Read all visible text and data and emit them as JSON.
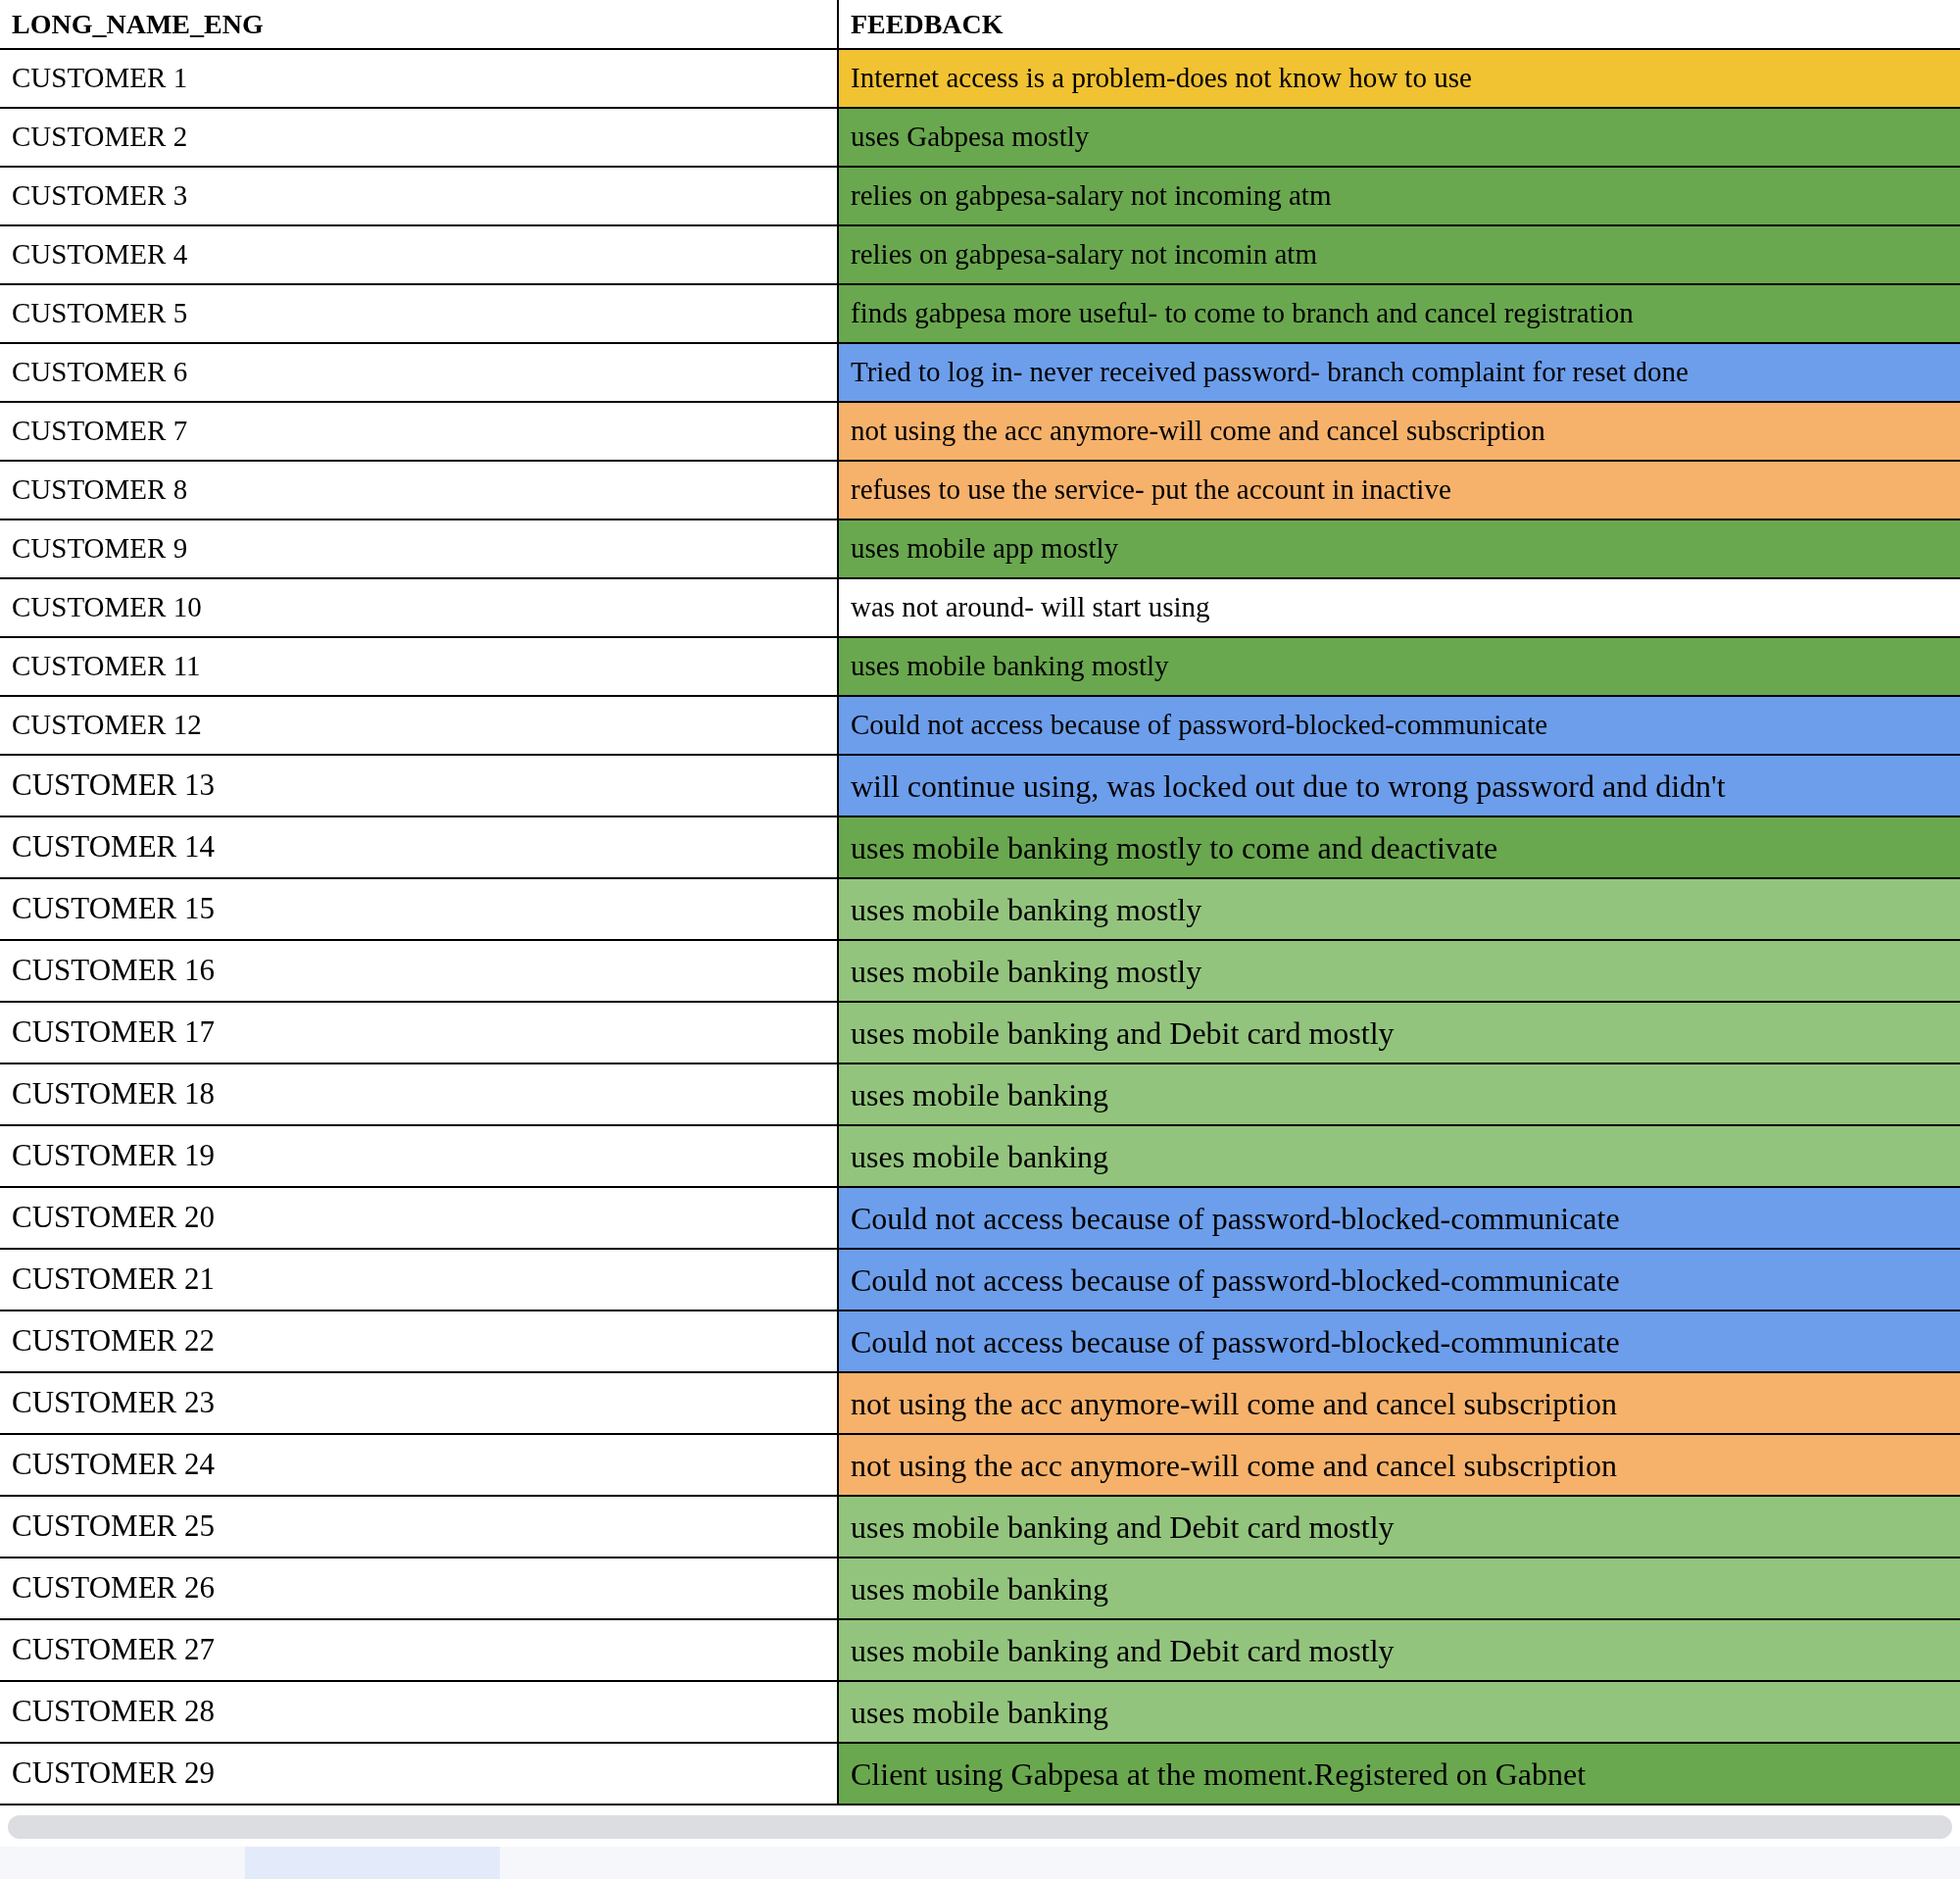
{
  "table": {
    "columns": [
      "LONG_NAME_ENG",
      "FEEDBACK"
    ],
    "rows": [
      {
        "name": "CUSTOMER 1",
        "feedback": "Internet access is a problem-does not know how to use",
        "color": "#f1c232"
      },
      {
        "name": "CUSTOMER 2",
        "feedback": "uses Gabpesa mostly",
        "color": "#6aa84f"
      },
      {
        "name": "CUSTOMER 3",
        "feedback": "relies on gabpesa-salary not incoming atm",
        "color": "#6aa84f"
      },
      {
        "name": "CUSTOMER 4",
        "feedback": "relies on gabpesa-salary not incomin atm",
        "color": "#6aa84f"
      },
      {
        "name": "CUSTOMER 5",
        "feedback": "finds gabpesa more useful- to come to branch and cancel registration",
        "color": "#6aa84f"
      },
      {
        "name": "CUSTOMER 6",
        "feedback": "Tried to log in- never received password- branch complaint for reset done",
        "color": "#6d9eeb"
      },
      {
        "name": "CUSTOMER 7",
        "feedback": "not using the acc anymore-will come and cancel subscription",
        "color": "#f6b26b"
      },
      {
        "name": "CUSTOMER 8",
        "feedback": "refuses to use the service- put the account in inactive",
        "color": "#f6b26b"
      },
      {
        "name": "CUSTOMER 9",
        "feedback": "uses mobile app mostly",
        "color": "#6aa84f"
      },
      {
        "name": "CUSTOMER 10",
        "feedback": "was not around- will start using",
        "color": "#ffffff"
      },
      {
        "name": "CUSTOMER 11",
        "feedback": "uses mobile banking mostly",
        "color": "#6aa84f"
      },
      {
        "name": "CUSTOMER 12",
        "feedback": "Could not access because of password-blocked-communicate",
        "color": "#6d9eeb"
      },
      {
        "name": "CUSTOMER 13",
        "feedback": "will continue using, was locked out due to wrong password and didn't",
        "color": "#6d9eeb"
      },
      {
        "name": "CUSTOMER 14",
        "feedback": "uses mobile banking mostly to come and deactivate",
        "color": "#6aa84f"
      },
      {
        "name": "CUSTOMER 15",
        "feedback": "uses mobile banking mostly",
        "color": "#93c47d"
      },
      {
        "name": "CUSTOMER 16",
        "feedback": "uses mobile banking mostly",
        "color": "#93c47d"
      },
      {
        "name": "CUSTOMER 17",
        "feedback": "uses mobile banking and Debit card  mostly",
        "color": "#93c47d"
      },
      {
        "name": "CUSTOMER 18",
        "feedback": "uses mobile banking",
        "color": "#93c47d"
      },
      {
        "name": "CUSTOMER 19",
        "feedback": "uses mobile banking",
        "color": "#93c47d"
      },
      {
        "name": "CUSTOMER 20",
        "feedback": "Could not access because of password-blocked-communicate",
        "color": "#6d9eeb"
      },
      {
        "name": "CUSTOMER 21",
        "feedback": "Could not access because of password-blocked-communicate",
        "color": "#6d9eeb"
      },
      {
        "name": "CUSTOMER 22",
        "feedback": "Could not access because of password-blocked-communicate",
        "color": "#6d9eeb"
      },
      {
        "name": "CUSTOMER 23",
        "feedback": "not using the acc anymore-will come and cancel subscription",
        "color": "#f6b26b"
      },
      {
        "name": "CUSTOMER 24",
        "feedback": "not using the acc anymore-will come and cancel subscription",
        "color": "#f6b26b"
      },
      {
        "name": "CUSTOMER 25",
        "feedback": "uses mobile banking and Debit card  mostly",
        "color": "#93c47d"
      },
      {
        "name": "CUSTOMER 26",
        "feedback": "uses mobile banking",
        "color": "#93c47d"
      },
      {
        "name": "CUSTOMER 27",
        "feedback": "uses mobile banking and Debit card  mostly",
        "color": "#93c47d"
      },
      {
        "name": "CUSTOMER 28",
        "feedback": "uses mobile banking",
        "color": "#93c47d"
      },
      {
        "name": "CUSTOMER 29",
        "feedback": "Client using Gabpesa at the moment.Registered on Gabnet",
        "color": "#6aa84f"
      }
    ]
  }
}
